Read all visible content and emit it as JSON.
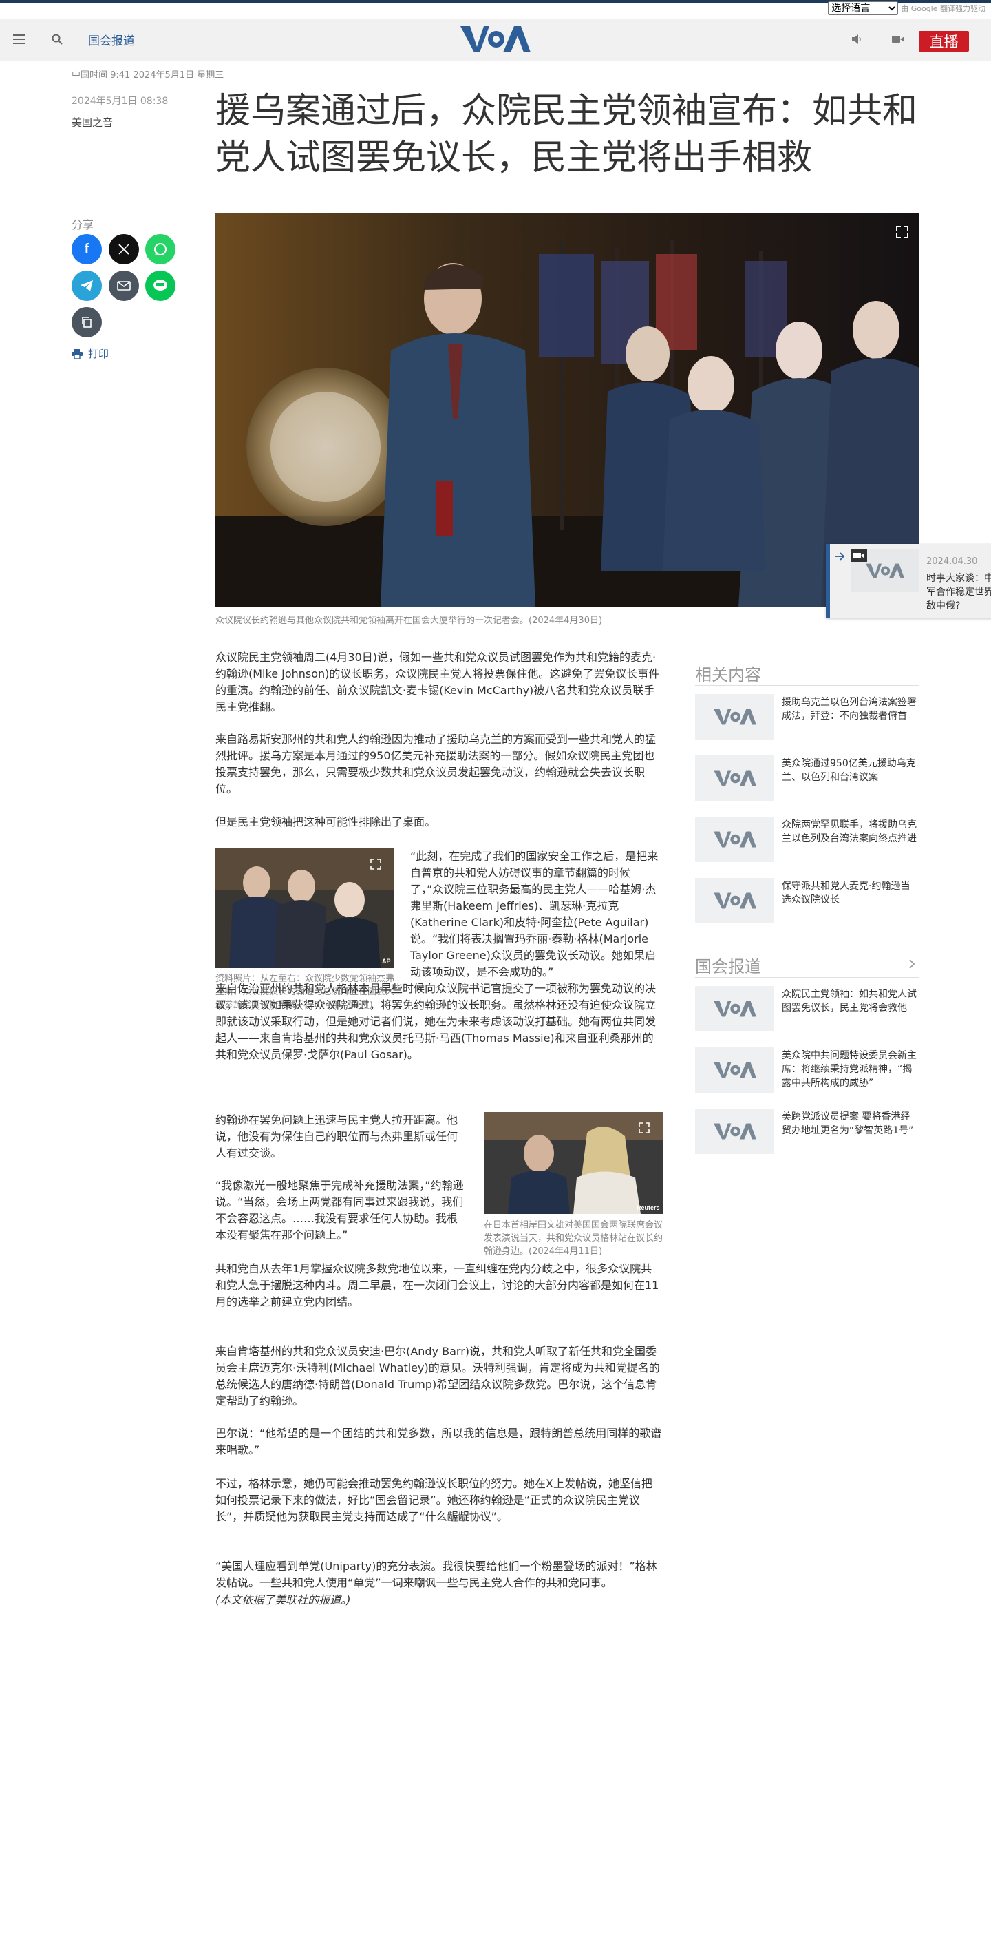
{
  "translate": {
    "select_value": "选择语言",
    "powered_by": "由 Google 翻译强力驱动"
  },
  "nav": {
    "section": "国会报道",
    "live_label": "直播",
    "logo_text": "VOA"
  },
  "article": {
    "dateline": "中国时间 9:41 2024年5月1日 星期三",
    "pubtime": "2024年5月1日 08:38",
    "author": "美国之音",
    "headline": "援乌案通过后，众院民主党领袖宣布：如共和党人试图罢免议长，民主党将出手相救",
    "hero_caption": "众议院议长约翰逊与其他众议院共和党领袖离开在国会大厦举行的一次记者会。(2024年4月30日)",
    "paragraphs": [
      "众议院民主党领袖周二(4月30日)说，假如一些共和党众议员试图罢免作为共和党籍的麦克·约翰逊(Mike Johnson)的议长职务，众议院民主党人将投票保住他。这避免了罢免议长事件的重演。约翰逊的前任、前众议院凯文·麦卡锡(Kevin McCarthy)被八名共和党众议员联手民主党推翻。",
      "来自路易斯安那州的共和党人约翰逊因为推动了援助乌克兰的方案而受到一些共和党人的猛烈批评。援乌方案是本月通过的950亿美元补充援助法案的一部分。假如众议院民主党团也投票支持罢免，那么，只需要极少数共和党众议员发起罢免动议，约翰逊就会失去议长职位。",
      "但是民主党领袖把这种可能性排除出了桌面。",
      "“此刻，在完成了我们的国家安全工作之后，是把来自普京的共和党人妨碍议事的章节翻篇的时候了，”众议院三位职务最高的民主党人——哈基姆·杰弗里斯(Hakeem Jeffries)、凯瑟琳·克拉克(Katherine Clark)和皮特·阿奎拉(Pete Aguilar)说。“我们将表决搁置玛乔丽·泰勒·格林(Marjorie Taylor Greene)众议员的罢免议长动议。她如果启动该项动议，是不会成功的。”",
      "来自佐治亚州的共和党人格林本月早些时候向众议院书记官提交了一项被称为罢免动议的决议，该决议如果获得众议院通过，将罢免约翰逊的议长职务。虽然格林还没有迫使众议院立即就该动议采取行动，但是她对记者们说，她在为未来考虑该动议打基础。她有两位共同发起人——来自肯塔基州的共和党众议员托马斯·马西(Thomas Massie)和来自亚利桑那州的共和党众议员保罗·戈萨尔(Paul Gosar)。",
      "约翰逊在罢免问题上迅速与民主党人拉开距离。他说，他没有为保住自己的职位而与杰弗里斯或任何人有过交谈。",
      "“我像激光一般地聚焦于完成补充援助法案，”约翰逊说。“当然，会场上两党都有同事过来跟我说，我们不会容忍这点。……我没有要求任何人协助。我根本没有聚焦在那个问题上。”",
      "共和党自从去年1月掌握众议院多数党地位以来，一直纠缠在党内分歧之中，很多众议院共和党人急于摆脱这种内斗。周二早晨，在一次闭门会议上，讨论的大部分内容都是如何在11月的选举之前建立党内团结。",
      "来自肯塔基州的共和党众议员安迪·巴尔(Andy Barr)说，共和党人听取了新任共和党全国委员会主席迈克尔·沃特利(Michael Whatley)的意见。沃特利强调，肯定将成为共和党提名的总统候选人的唐纳德·特朗普(Donald Trump)希望团结众议院多数党。巴尔说，这个信息肯定帮助了约翰逊。",
      "巴尔说：“他希望的是一个团结的共和党多数，所以我的信息是，跟特朗普总统用同样的歌谱来唱歌。”",
      "不过，格林示意，她仍可能会推动罢免约翰逊议长职位的努力。她在X上发帖说，她坚信把如何投票记录下来的做法，好比“国会留记录”。她还称约翰逊是“正式的众议院民主党议长”，并质疑他为获取民主党支持而达成了“什么龌龊协议”。",
      "“美国人理应看到单党(Uniparty)的充分表演。我很快要给他们一个粉墨登场的派对！”格林发帖说。一些共和党人使用“单党”一词来嘲讽一些与民主党人合作的共和党同事。",
      "(本文依据了美联社的报道。)"
    ],
    "inline1": {
      "caption": "资料照片：从左至右：众议院少数党领袖杰弗里斯、众议院议长约翰逊与总统拜登在国会大厦参加全国祈祷早餐。(2024年2月1日)",
      "credit": "AP"
    },
    "inline2": {
      "caption": "在日本首相岸田文雄对美国国会两院联席会议发表演说当天，共和党众议员格林站在议长约翰逊身边。(2024年4月11日)",
      "credit": "Reuters"
    }
  },
  "share": {
    "label": "分享",
    "print_label": "打印"
  },
  "related": {
    "title": "相关内容",
    "items": [
      "援助乌克兰以色列台湾法案签署成法，拜登：不向独裁者俯首",
      "美众院通过950亿美元援助乌克兰、以色列和台湾议案",
      "众院两党罕见联手，将援助乌克兰以色列及台湾法案向终点推进",
      "保守派共和党人麦克·约翰逊当选众议院议长"
    ]
  },
  "congress": {
    "title": "国会报道",
    "items": [
      "众院民主党领袖：如共和党人试图罢免议长，民主党将会救他",
      "美众院中共问题特设委员会新主席：将继续秉持党派精神，“揭露中共所构成的威胁”",
      "美跨党派议员提案 要将香港经贸办地址更名为“黎智英路1号”"
    ]
  },
  "popup": {
    "date": "2024.04.30",
    "title": "时事大家谈：中俄军合作稳定世界，敌中俄?"
  },
  "colors": {
    "brand_blue": "#2d5e97",
    "live_red": "#cc1d26",
    "header_bg": "#f1f1f1"
  }
}
